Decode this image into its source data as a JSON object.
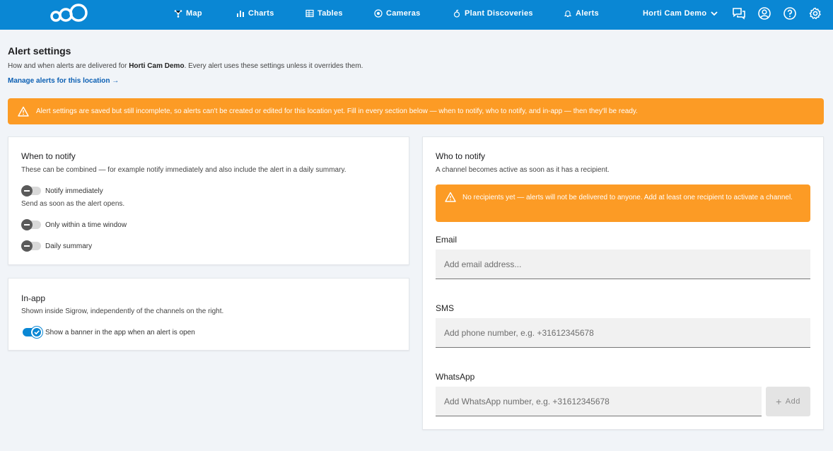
{
  "nav": {
    "items": [
      {
        "label": "Map",
        "icon": "map-icon"
      },
      {
        "label": "Charts",
        "icon": "bar-chart-icon"
      },
      {
        "label": "Tables",
        "icon": "table-icon"
      },
      {
        "label": "Cameras",
        "icon": "camera-icon"
      },
      {
        "label": "Plant Discoveries",
        "icon": "plant-icon"
      },
      {
        "label": "Alerts",
        "icon": "bell-icon"
      }
    ],
    "location": "Horti Cam Demo",
    "icons": [
      "chat-icon",
      "account-icon",
      "help-icon",
      "gear-icon"
    ]
  },
  "header": {
    "title": "Alert settings",
    "sub_prefix": "How and when alerts are delivered for ",
    "sub_location": "Horti Cam Demo",
    "sub_suffix": ". Every alert uses these settings unless it overrides them.",
    "manage_link": "Manage alerts for this location →"
  },
  "banner": {
    "text": "Alert settings are saved but still incomplete, so alerts can't be created or edited for this location yet. Fill in every section below — when to notify, who to notify, and in-app — then they'll be ready."
  },
  "when": {
    "title": "When to notify",
    "desc": "These can be combined — for example notify immediately and also include the alert in a daily summary.",
    "options": [
      {
        "label": "Notify immediately",
        "enabled": false,
        "note": "Send as soon as the alert opens."
      },
      {
        "label": "Only within a time window",
        "enabled": false,
        "note": ""
      },
      {
        "label": "Daily summary",
        "enabled": false,
        "note": ""
      }
    ]
  },
  "inapp": {
    "title": "In-app",
    "desc": "Shown inside Sigrow, independently of the channels on the right.",
    "toggle_label": "Show a banner in the app when an alert is open",
    "enabled": true
  },
  "who": {
    "title": "Who to notify",
    "desc": "A channel becomes active as soon as it has a recipient.",
    "warning": "No recipients yet — alerts will not be delivered to anyone. Add at least one recipient to activate a channel.",
    "email": {
      "label": "Email",
      "placeholder": "Add email address..."
    },
    "sms": {
      "label": "SMS",
      "placeholder": "Add phone number, e.g. +31612345678"
    },
    "whatsapp": {
      "label": "WhatsApp",
      "placeholder": "Add WhatsApp number, e.g. +31612345678",
      "add_label": "Add"
    }
  },
  "colors": {
    "brand": "#0a87d4",
    "warning": "#fc9b25",
    "link": "#0b5fb3",
    "background": "#f1f4f8"
  }
}
